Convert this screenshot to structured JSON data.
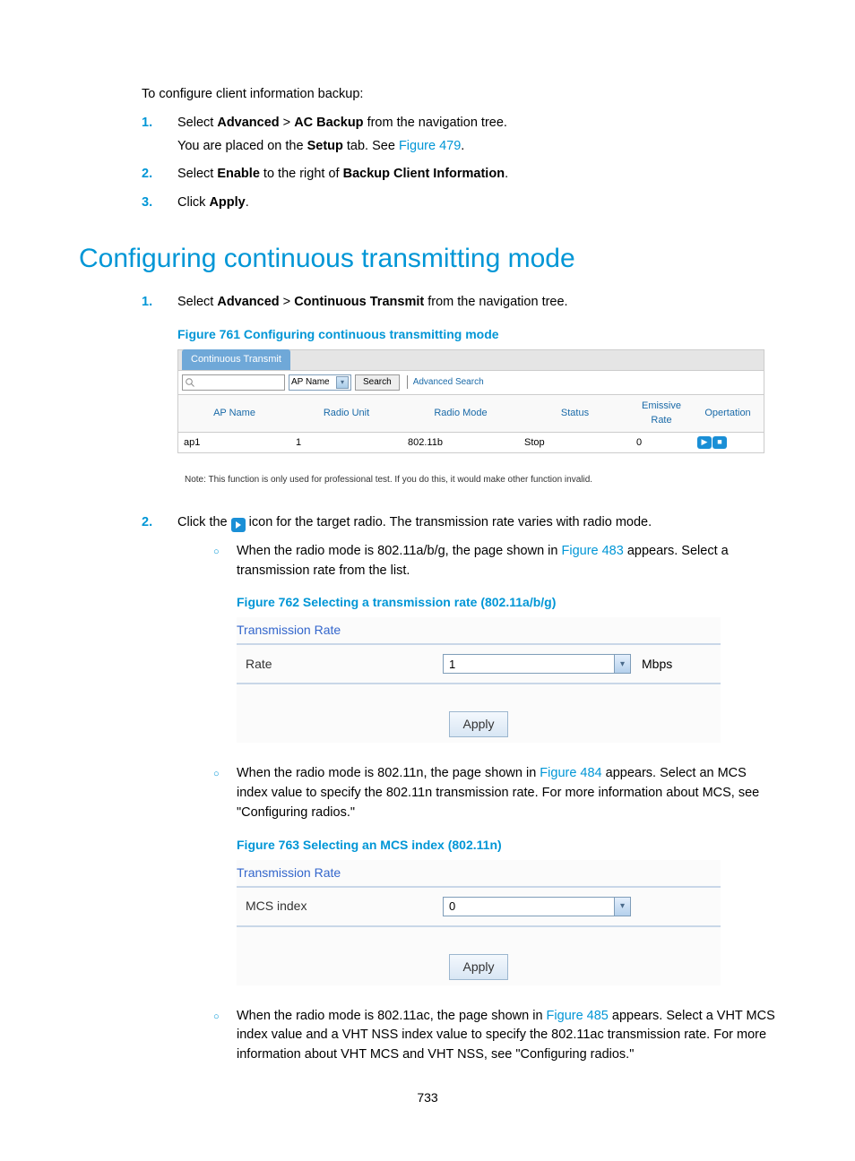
{
  "intro": "To configure client information backup:",
  "steps1": {
    "s1_a": "Select ",
    "s1_b": "Advanced",
    "s1_c": " > ",
    "s1_d": "AC Backup",
    "s1_e": " from the navigation tree.",
    "s1_sub_a": "You are placed on the ",
    "s1_sub_b": "Setup",
    "s1_sub_c": " tab. See ",
    "s1_sub_link": "Figure 479",
    "s1_sub_d": ".",
    "s2_a": "Select ",
    "s2_b": "Enable",
    "s2_c": " to the right of ",
    "s2_d": "Backup Client Information",
    "s2_e": ".",
    "s3_a": "Click ",
    "s3_b": "Apply",
    "s3_c": "."
  },
  "n1": "1.",
  "n2": "2.",
  "n3": "3.",
  "heading": "Configuring continuous transmitting mode",
  "sec2_step1_a": "Select ",
  "sec2_step1_b": "Advanced",
  "sec2_step1_c": " > ",
  "sec2_step1_d": "Continuous Transmit",
  "sec2_step1_e": " from the navigation tree.",
  "fig761_caption": "Figure 761 Configuring continuous transmitting mode",
  "fig761": {
    "tab": "Continuous Transmit",
    "select_val": "AP Name",
    "search_btn": "Search",
    "adv_search": "Advanced Search",
    "headers": {
      "ap": "AP Name",
      "ru": "Radio Unit",
      "rm": "Radio Mode",
      "st": "Status",
      "er": "Emissive Rate",
      "op": "Opertation"
    },
    "row": {
      "ap": "ap1",
      "ru": "1",
      "rm": "802.11b",
      "st": "Stop",
      "er": "0"
    }
  },
  "fig761_note": "Note: This function is only used for professional test. If you do this, it would make other function invalid.",
  "sec2_step2_a": "Click the ",
  "sec2_step2_b": " icon for the target radio. The transmission rate varies with radio mode.",
  "bullet1_a": "When the radio mode is 802.11a/b/g, the page shown in ",
  "bullet1_link": "Figure 483",
  "bullet1_b": " appears. Select a transmission rate from the list.",
  "fig762_caption": "Figure 762 Selecting a transmission rate (802.11a/b/g)",
  "fig762": {
    "title": "Transmission Rate",
    "label": "Rate",
    "value": "1",
    "unit": "Mbps",
    "apply": "Apply"
  },
  "bullet2_a": "When the radio mode is 802.11n, the page shown in ",
  "bullet2_link": "Figure 484",
  "bullet2_b": " appears. Select an MCS index value to specify the 802.11n transmission rate. For more information about MCS, see \"Configuring radios.\"",
  "fig763_caption": "Figure 763 Selecting an MCS index (802.11n)",
  "fig763": {
    "title": "Transmission Rate",
    "label": "MCS index",
    "value": "0",
    "apply": "Apply"
  },
  "bullet3_a": "When the radio mode is 802.11ac, the page shown in ",
  "bullet3_link": "Figure 485",
  "bullet3_b": " appears. Select a VHT MCS index value and a VHT NSS index value to specify the 802.11ac transmission rate. For more information about VHT MCS and VHT NSS, see \"Configuring radios.\"",
  "pagenum": "733",
  "chart_data": {
    "type": "table",
    "title": "Continuous Transmit radio list",
    "headers": [
      "AP Name",
      "Radio Unit",
      "Radio Mode",
      "Status",
      "Emissive Rate",
      "Opertation"
    ],
    "rows": [
      [
        "ap1",
        "1",
        "802.11b",
        "Stop",
        "0",
        ""
      ]
    ]
  }
}
